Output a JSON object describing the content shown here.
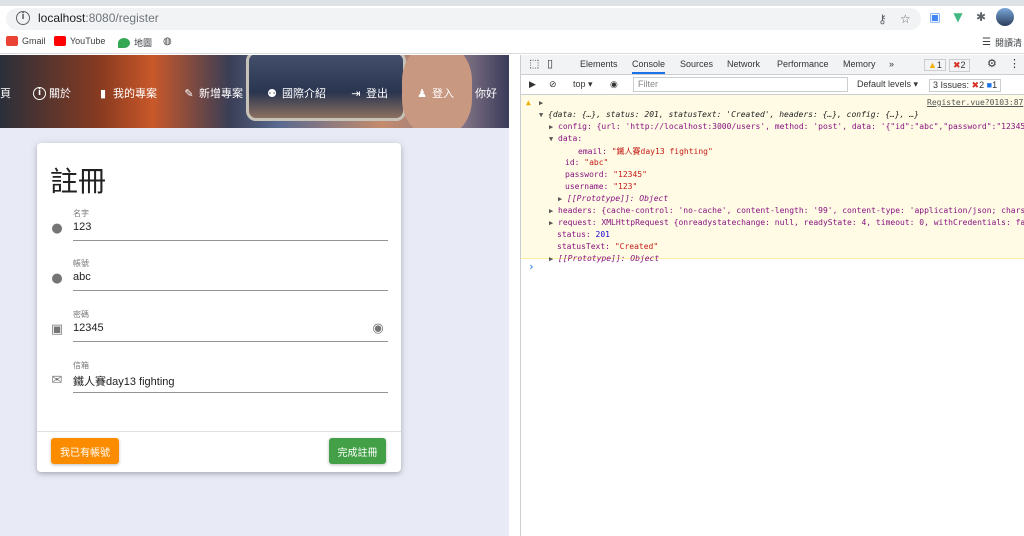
{
  "browser": {
    "url_host": "localhost",
    "url_path": ":8080/register",
    "bookmarks": [
      {
        "label": "Gmail",
        "color": "#ea4335"
      },
      {
        "label": "YouTube",
        "color": "#ff0000"
      },
      {
        "label": "地圖",
        "color": "#34a853"
      }
    ],
    "reading_list": "閱讀清"
  },
  "nav": {
    "items": [
      {
        "label": "頁",
        "icon": "home-icon"
      },
      {
        "label": "關於",
        "icon": "info-icon"
      },
      {
        "label": "我的專案",
        "icon": "file-icon"
      },
      {
        "label": "新增專案",
        "icon": "file-edit-icon"
      },
      {
        "label": "國際介紹",
        "icon": "people-icon"
      },
      {
        "label": "登出",
        "icon": "logout-icon"
      },
      {
        "label": "登入",
        "icon": "person-icon"
      },
      {
        "label": "你好",
        "icon": ""
      }
    ]
  },
  "form": {
    "title": "註冊",
    "fields": [
      {
        "label": "名字",
        "value": "123",
        "icon": "account-circle-icon"
      },
      {
        "label": "帳號",
        "value": "abc",
        "icon": "account-circle-icon"
      },
      {
        "label": "密碼",
        "value": "12345",
        "icon": "lock-icon"
      },
      {
        "label": "信箱",
        "value": "鐵人賽day13 fighting",
        "icon": "email-icon"
      }
    ],
    "have_account_label": "我已有帳號",
    "submit_label": "完成註冊",
    "colors": {
      "have_account": "#fb8c00",
      "submit": "#43a047"
    }
  },
  "devtools": {
    "tabs": [
      "Elements",
      "Console",
      "Sources",
      "Network",
      "Performance",
      "Memory"
    ],
    "more": "»",
    "warnings": "1",
    "errors": "2",
    "context": "top",
    "filter_placeholder": "Filter",
    "levels": "Default levels",
    "issues_label": "3 Issues:",
    "issues_errors": "2",
    "issues_info": "1",
    "source_link": "Register.vue?0103:87",
    "log": {
      "summary": "{data: {…}, status: 201, statusText: 'Created', headers: {…}, config: {…}, …}",
      "config_line": "config: {url: 'http://localhost:3000/users', method: 'post', data: '{\"id\":\"abc\",\"password\":\"12345…",
      "data_label": "data:",
      "email_key": "email:",
      "email_val": "\"鐵人賽day13 fighting\"",
      "id_key": "id:",
      "id_val": "\"abc\"",
      "password_key": "password:",
      "password_val": "\"12345\"",
      "username_key": "username:",
      "username_val": "\"123\"",
      "proto1": "[[Prototype]]: Object",
      "headers_line": "headers: {cache-control: 'no-cache', content-length: '99', content-type: 'application/json; chars…",
      "request_line": "request: XMLHttpRequest {onreadystatechange: null, readyState: 4, timeout: 0, withCredentials: fa…",
      "status_key": "status:",
      "status_val": "201",
      "statustext_key": "statusText:",
      "statustext_val": "\"Created\"",
      "proto2": "[[Prototype]]: Object"
    },
    "prompt": "›"
  }
}
